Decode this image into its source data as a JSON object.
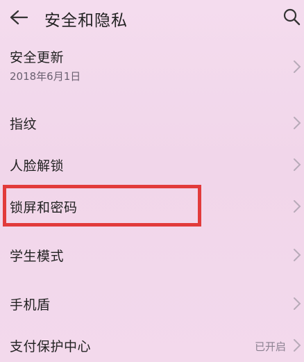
{
  "header": {
    "title": "安全和隐私",
    "back_icon": "back-arrow-icon",
    "search_icon": "search-icon"
  },
  "items": [
    {
      "label": "安全更新",
      "sub": "2018年6月1日"
    },
    {
      "label": "指纹"
    },
    {
      "label": "人脸解锁"
    },
    {
      "label": "锁屏和密码",
      "highlighted": true
    },
    {
      "label": "学生模式"
    },
    {
      "label": "手机盾"
    },
    {
      "label": "支付保护中心",
      "value": "已开启"
    }
  ],
  "colors": {
    "background": "#f3d9ec",
    "highlight": "#e23b3b",
    "chevron": "#b7aab8"
  }
}
